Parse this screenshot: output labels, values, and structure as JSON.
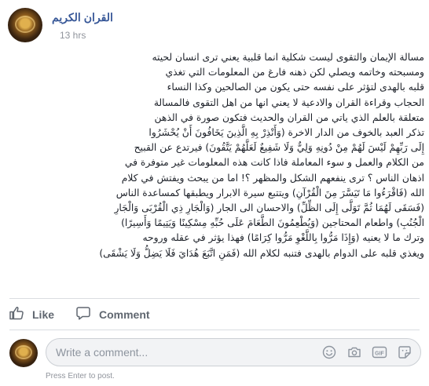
{
  "post": {
    "page_name": "القران الكريم",
    "timestamp": "13 hrs",
    "body_lines": [
      "مسالة الإيمان والتقوى ليست شكلية انما قلبية يعني ترى انسان لحيته",
      "ومسبحته وخاتمه ويصلي لكن ذهنه فارغ من المعلومات التي تغذي",
      "قلبه بالهدى لتؤثر على نفسه حتى يكون من الصالحين وكذا النساء",
      "الحجاب وقراءة القران والادعية لا يعني انها من اهل التقوى فالمسالة",
      "متعلقة بالعلم الذي ياتي من القران والحديث فتكون صورة في الذهن",
      "تذكر العبد بالخوف من الدار الاخرة (وَأَنْذِرْ بِهِ الَّذِينَ يَخَافُونَ أَنْ يُحْشَرُوا",
      "إِلَى رَبِّهِمْ لَيْسَ لَهُمْ مِنْ دُونِهِ وَلِيٌّ وَلَا شَفِيعٌ لَعَلَّهُمْ يَتَّقُونَ) فيرتدع عن القبيح",
      "من الكلام والعمل و سوء المعاملة فاذا كانت هذه المعلومات غير متوفرة في",
      "اذهان الناس ؟ ترى ينفعهم الشكل والمظهر ؟! اما من يبحث ويفتش في كلام",
      "الله (فَاقْرَءُوا مَا تَيَسَّرَ مِنَ الْقُرْآنِ) ويتتبع سيرة الابرار ويطبقها كمساعدة الناس",
      "(فَسَقَى لَهُمَا ثُمَّ تَوَلَّى إِلَى الظِّلِّ) والاحسان الى الجار (وَالْجَارِ ذِي الْقُرْبَى وَالْجَارِ",
      "الْجُنُبِ) واطعام المحتاجين (وَيُطْعِمُونَ الطَّعَامَ عَلَى حُبِّهِ مِسْكِينًا وَيَتِيمًا وَأَسِيرًا)",
      "وترك ما لا يعنيه (وَإِذَا مَرُّوا بِاللَّغْوِ مَرُّوا كِرَامًا) فهذا يؤثر في عقله وروحه",
      "ويغذي قلبه على الدوام بالهدى فتنبه لكلام الله (فَمَنِ اتَّبَعَ هُدَايَ فَلَا يَضِلُّ وَلَا يَشْقَى)"
    ]
  },
  "actions": {
    "like_label": "Like",
    "comment_label": "Comment"
  },
  "comment_composer": {
    "placeholder": "Write a comment...",
    "hint": "Press Enter to post.",
    "tools": [
      "emoji-icon",
      "camera-icon",
      "gif-icon",
      "sticker-icon"
    ]
  },
  "colors": {
    "page_name": "#385898",
    "timestamp": "#90949c",
    "action_text": "#606770",
    "divider": "#dadde1",
    "composer_bg": "#f2f3f5"
  }
}
